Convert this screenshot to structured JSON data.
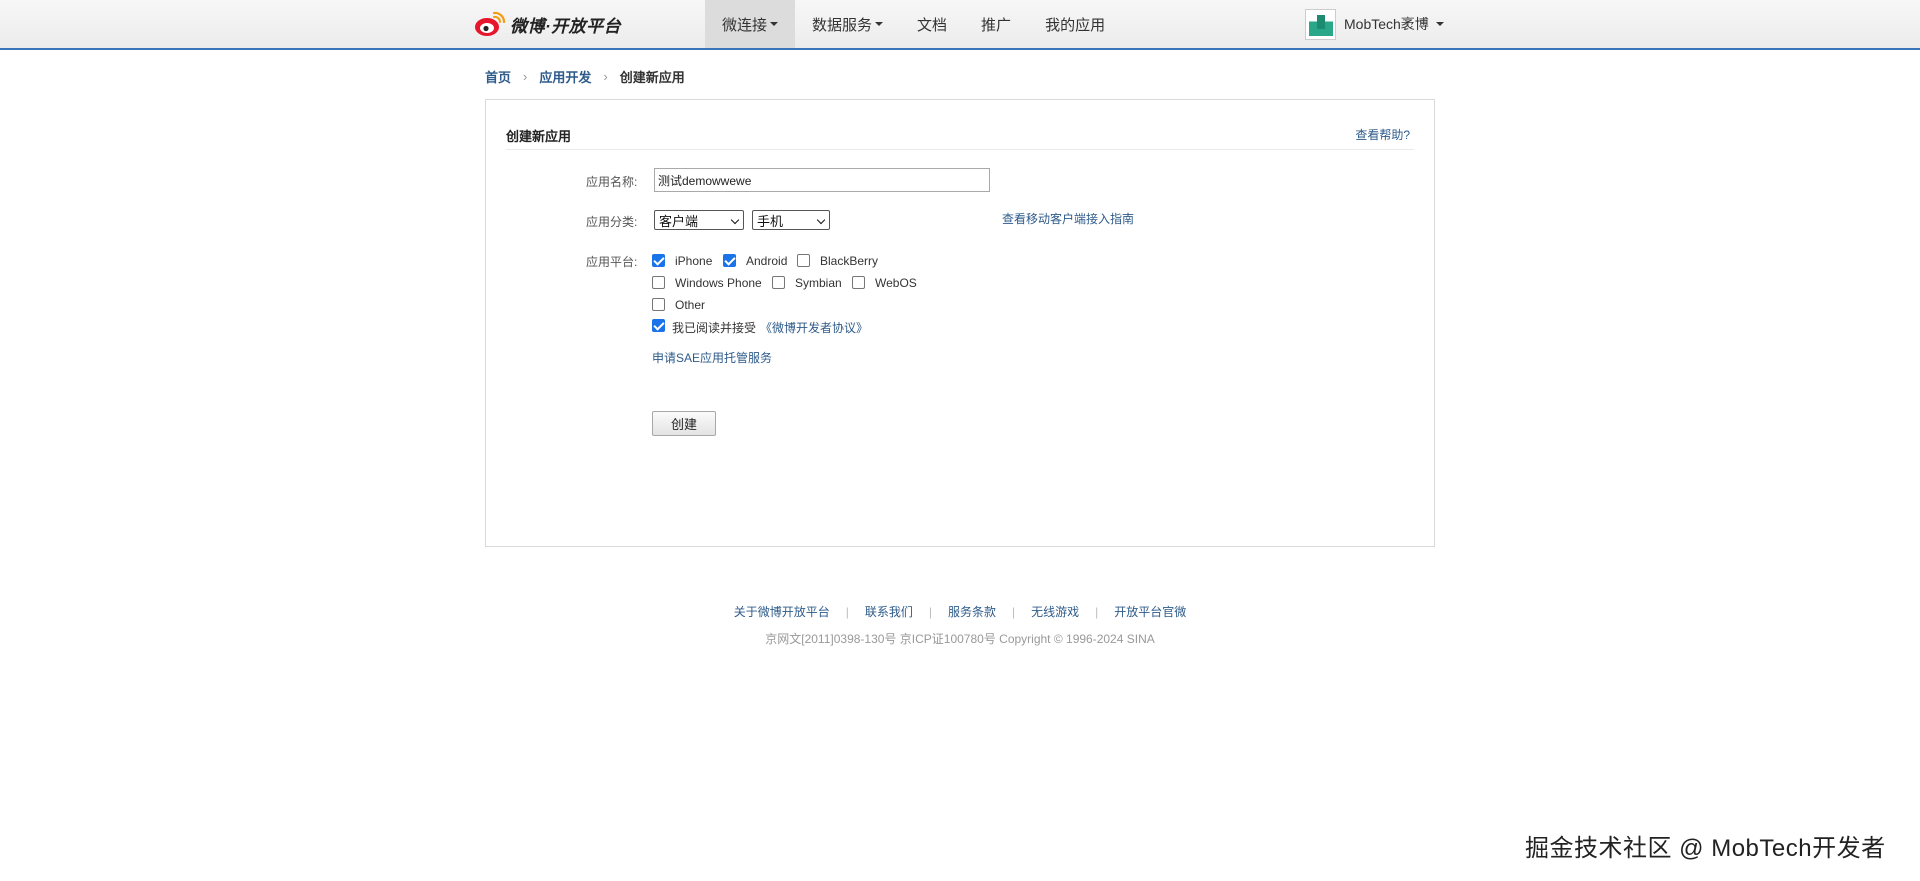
{
  "header": {
    "logo_text": "微博·开放平台",
    "nav": [
      {
        "label": "微连接",
        "dropdown": true,
        "active": true
      },
      {
        "label": "数据服务",
        "dropdown": true,
        "active": false
      },
      {
        "label": "文档",
        "dropdown": false,
        "active": false
      },
      {
        "label": "推广",
        "dropdown": false,
        "active": false
      },
      {
        "label": "我的应用",
        "dropdown": false,
        "active": false
      }
    ],
    "user_name": "MobTech袤博"
  },
  "breadcrumb": {
    "home": "首页",
    "section": "应用开发",
    "current": "创建新应用"
  },
  "panel": {
    "title": "创建新应用",
    "help_link": "查看帮助?"
  },
  "form": {
    "app_name_label": "应用名称:",
    "app_name_value": "测试demowwewe",
    "category_label": "应用分类:",
    "category_value": "客户端",
    "subcategory_value": "手机",
    "guide_link": "查看移动客户端接入指南",
    "platform_label": "应用平台:",
    "platforms": [
      {
        "label": "iPhone",
        "checked": true
      },
      {
        "label": "Android",
        "checked": true
      },
      {
        "label": "BlackBerry",
        "checked": false
      },
      {
        "label": "Windows Phone",
        "checked": false
      },
      {
        "label": "Symbian",
        "checked": false
      },
      {
        "label": "WebOS",
        "checked": false
      },
      {
        "label": "Other",
        "checked": false
      }
    ],
    "agree_checked": true,
    "agree_text": "我已阅读并接受",
    "agree_link": "《微博开发者协议》",
    "sae_link": "申请SAE应用托管服务",
    "submit_label": "创建"
  },
  "footer": {
    "links": [
      "关于微博开放平台",
      "联系我们",
      "服务条款",
      "无线游戏",
      "开放平台官微"
    ],
    "separator": "|",
    "copyright": "京网文[2011]0398-130号 京ICP证100780号 Copyright © 1996-2024 SINA"
  },
  "watermark": "掘金技术社区 @ MobTech开发者",
  "colors": {
    "link": "#2e5b8a",
    "nav_border": "#3b73b9",
    "checkbox_checked": "#1a73e8"
  }
}
